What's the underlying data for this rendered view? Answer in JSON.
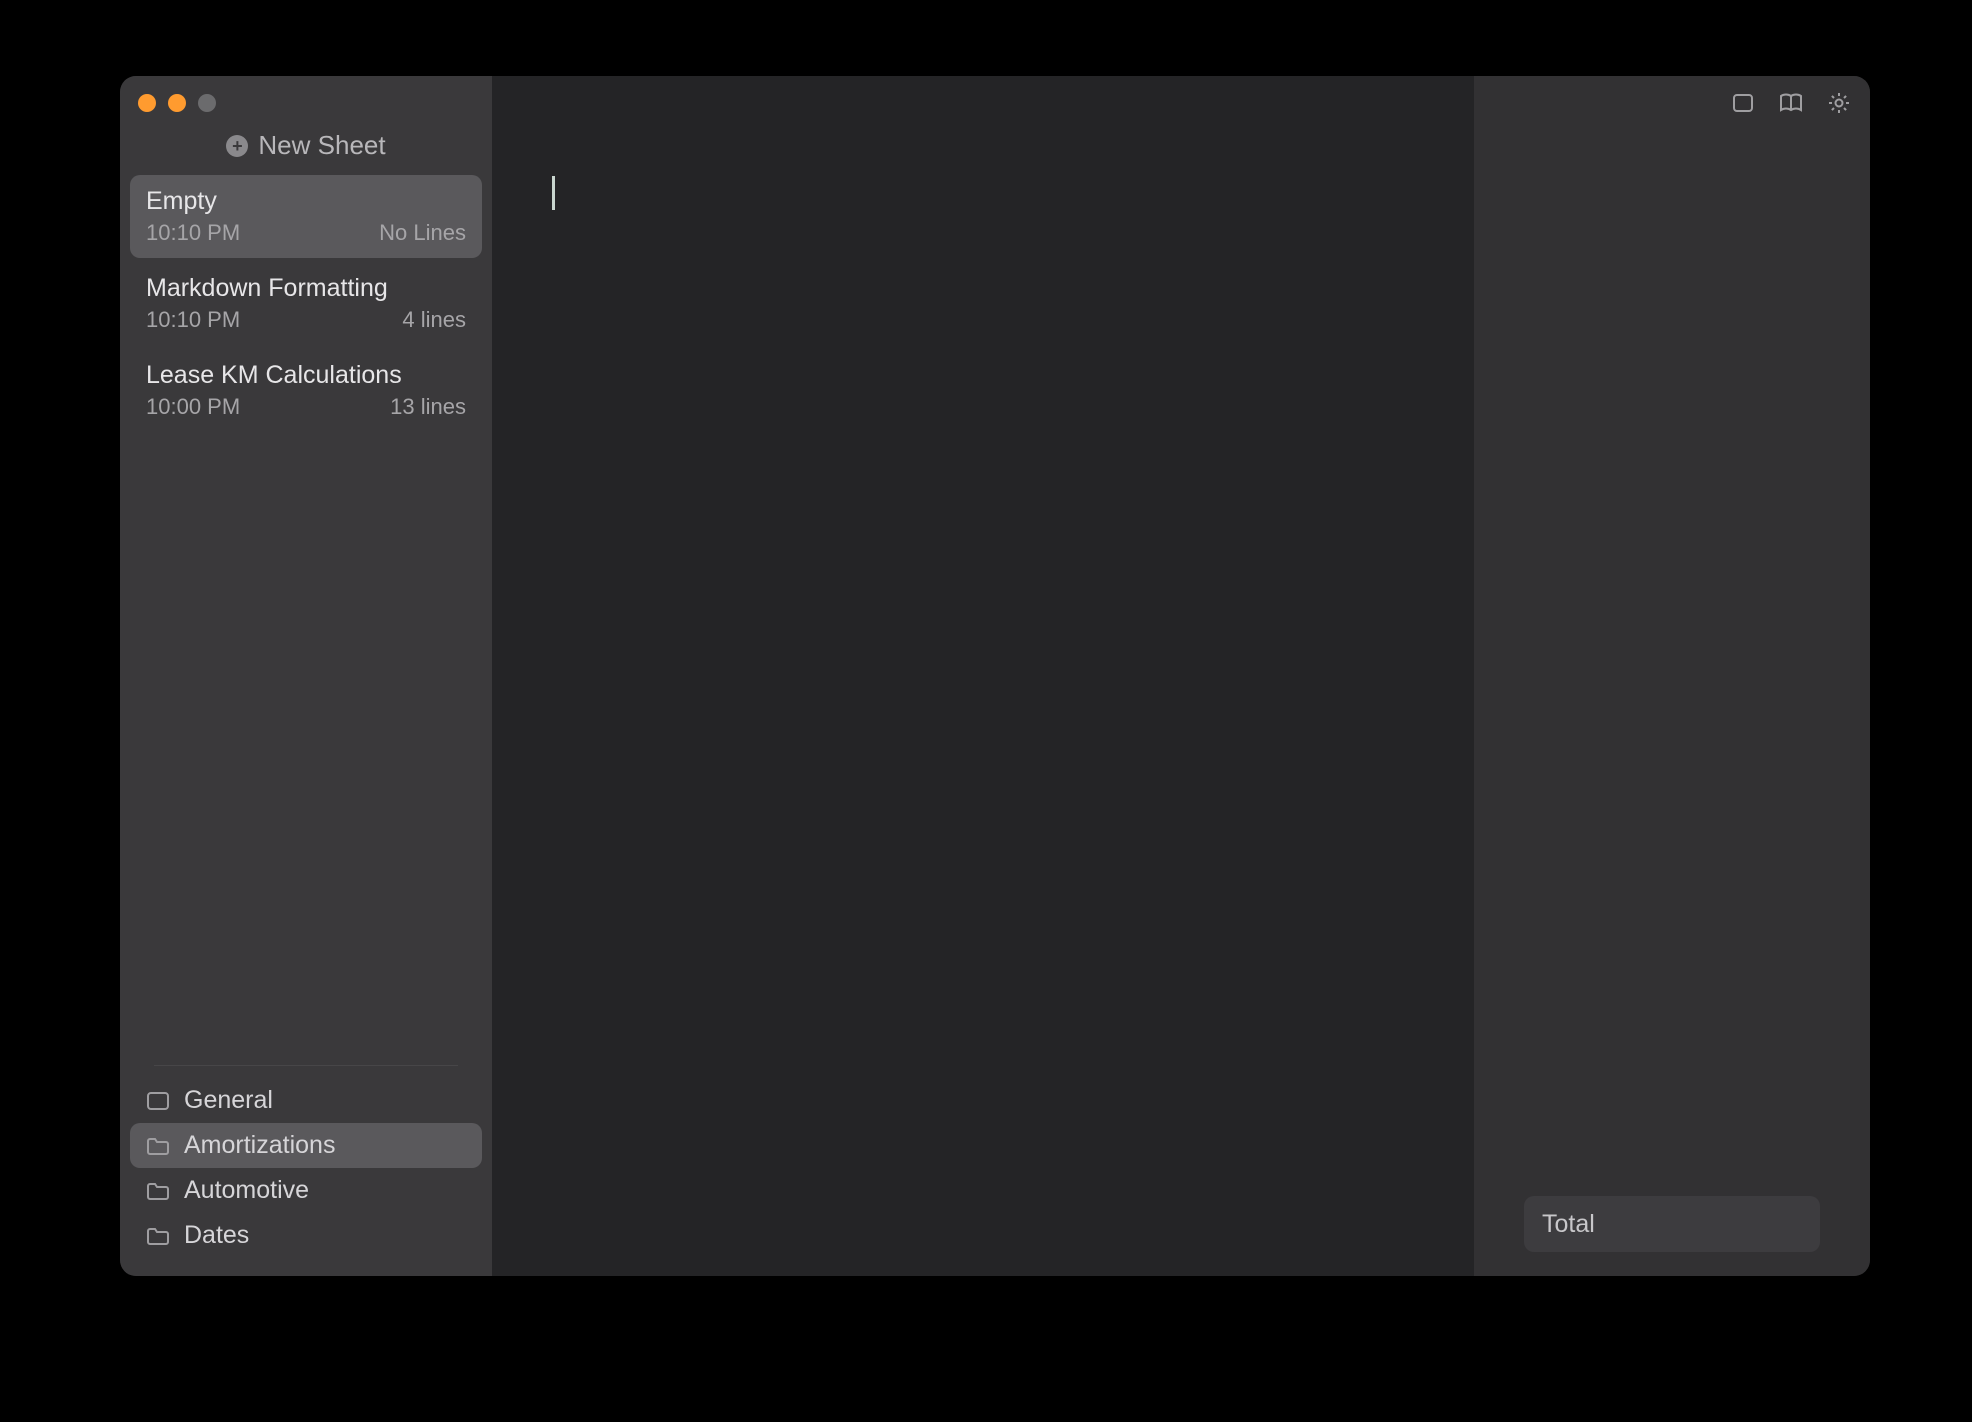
{
  "new_sheet_label": "New Sheet",
  "sheets": [
    {
      "title": "Empty",
      "time": "10:10 PM",
      "lines": "No Lines",
      "selected": true
    },
    {
      "title": "Markdown Formatting",
      "time": "10:10 PM",
      "lines": "4 lines",
      "selected": false
    },
    {
      "title": "Lease KM Calculations",
      "time": "10:00 PM",
      "lines": "13 lines",
      "selected": false
    }
  ],
  "folders": [
    {
      "label": "General",
      "icon": "rect",
      "selected": false
    },
    {
      "label": "Amortizations",
      "icon": "folder",
      "selected": true
    },
    {
      "label": "Automotive",
      "icon": "folder",
      "selected": false
    },
    {
      "label": "Dates",
      "icon": "folder",
      "selected": false
    }
  ],
  "total_label": "Total"
}
